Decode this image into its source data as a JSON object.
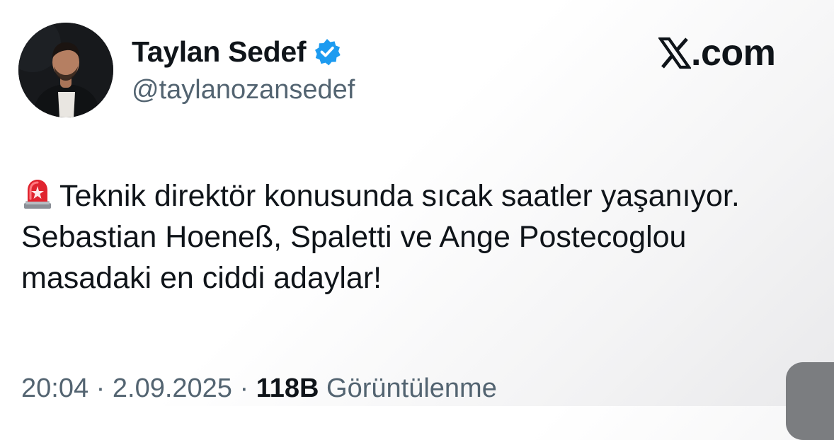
{
  "tweet": {
    "author": {
      "display_name": "Taylan Sedef",
      "handle": "@taylanozansedef",
      "verified": true,
      "verified_color": "#1d9bf0",
      "avatar_icon": "profile-photo"
    },
    "source_logo": {
      "mark": "𝕏",
      "domain": ".com"
    },
    "text": {
      "emoji": "🚨",
      "emoji_icon": "police-siren-icon",
      "body": "Teknik direktör konusunda sıcak saatler yaşanıyor. Sebastian Hoeneß, Spaletti ve Ange Postecoglou masadaki en ciddi adaylar!"
    },
    "meta": {
      "time": "20:04",
      "separator_1": " · ",
      "date": "2.09.2025",
      "separator_2": " · ",
      "views_count": "118B",
      "views_label": " Görüntülenme"
    }
  },
  "colors": {
    "text_primary": "#0f1419",
    "text_secondary": "#536471"
  }
}
